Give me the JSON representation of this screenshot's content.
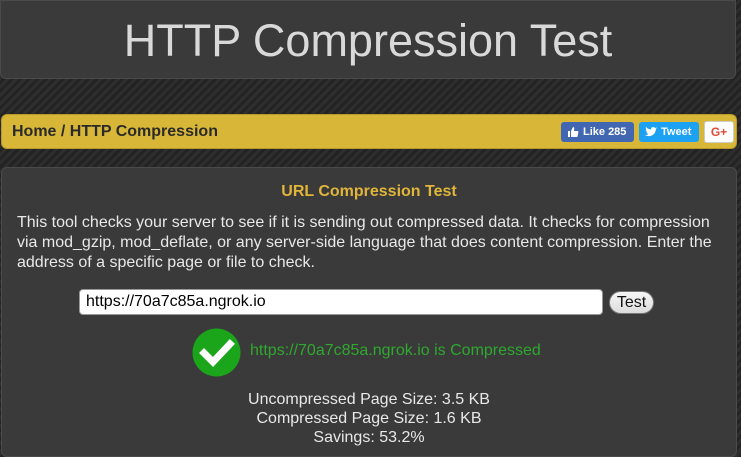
{
  "header": {
    "title": "HTTP Compression Test"
  },
  "breadcrumb": {
    "text": "Home / HTTP Compression"
  },
  "social": {
    "fb_label": "Like 285",
    "tw_label": "Tweet",
    "gp_label": "G+"
  },
  "panel": {
    "title": "URL Compression Test",
    "description": "This tool checks your server to see if it is sending out compressed data. It checks for compression via mod_gzip, mod_deflate, or any server-side language that does content compression. Enter the address of a specific page or file to check."
  },
  "form": {
    "url_value": "https://70a7c85a.ngrok.io",
    "button_label": "Test"
  },
  "result": {
    "message": "https://70a7c85a.ngrok.io is Compressed",
    "uncompressed": "Uncompressed Page Size: 3.5 KB",
    "compressed": "Compressed Page Size: 1.6 KB",
    "savings": "Savings: 53.2%"
  },
  "colors": {
    "accent": "#d8b738",
    "success": "#2fa82f",
    "title": "#e0b53a"
  }
}
